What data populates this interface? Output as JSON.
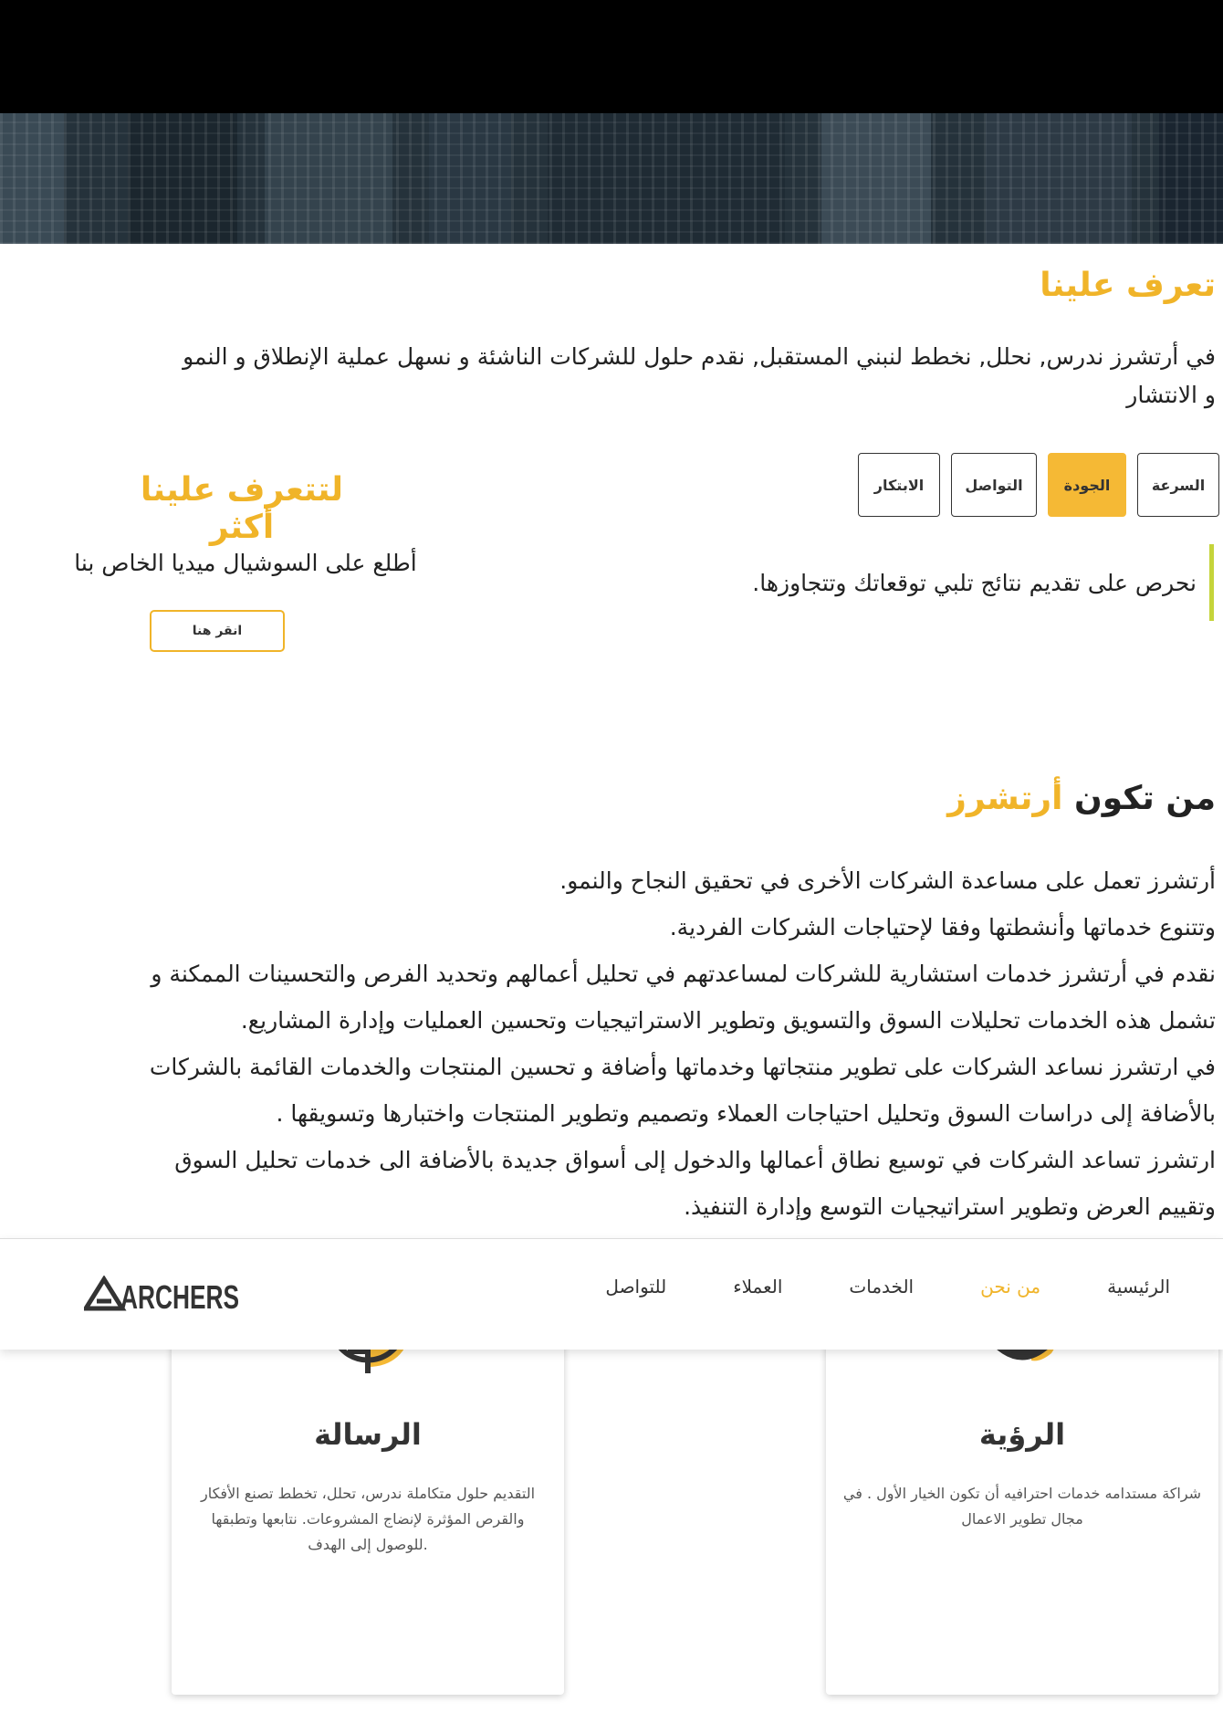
{
  "about": {
    "title": "تعرف علينا",
    "text": "في أرتشرز ندرس, نحلل, نخطط لنبني المستقبل, نقدم حلول للشركات الناشئة و نسهل عملية الإنطلاق و النمو و الانتشار"
  },
  "tabs": [
    {
      "label": "السرعة"
    },
    {
      "label": "الجودة"
    },
    {
      "label": "التواصل"
    },
    {
      "label": "الابتكار"
    }
  ],
  "tab_content": "نحرص على تقديم نتائج تلبي توقعاتك وتتجاوزها.",
  "learn": {
    "title": "لتتعرف علينا أكثر",
    "subtitle": "أطلع على السوشيال ميديا الخاص بنا",
    "button": "انقر هنا"
  },
  "who": {
    "title_prefix": "من تكون",
    "title_brand": "أرتشرز",
    "lines": [
      "أرتشرز تعمل على مساعدة الشركات الأخرى في تحقيق النجاح والنمو.",
      "وتتنوع خدماتها وأنشطتها وفقا لإحتياجات الشركات الفردية.",
      "نقدم في أرتشرز خدمات استشارية للشركات لمساعدتهم في تحليل أعمالهم وتحديد الفرص والتحسينات الممكنة و",
      "تشمل هذه الخدمات تحليلات السوق والتسويق وتطوير الاستراتيجيات وتحسين العمليات وإدارة المشاريع.",
      "في ارتشرز نساعد الشركات على تطوير منتجاتها وخدماتها وأضافة و تحسين المنتجات والخدمات القائمة بالشركات",
      "بالأضافة إلى دراسات السوق وتحليل احتياجات العملاء وتصميم وتطوير المنتجات واختبارها وتسويقها .",
      "ارتشرز تساعد الشركات في توسيع نطاق أعمالها والدخول إلى أسواق جديدة بالأضافة الى خدمات تحليل السوق",
      "وتقييم العرض وتطوير استراتيجيات التوسع وإدارة التنفيذ."
    ]
  },
  "navbar": {
    "logo_text": "ARCHERS",
    "items": [
      {
        "label": "الرئيسية"
      },
      {
        "label": "من نحن"
      },
      {
        "label": "الخدمات"
      },
      {
        "label": "العملاء"
      },
      {
        "label": "للتواصل"
      }
    ],
    "active_index": 1
  },
  "cards": {
    "vision": {
      "title": "الرؤية",
      "text": "شراكة مستدامه خدمات احترافيه أن تكون الخيار الأول . في مجال تطوير الاعمال",
      "icon": "eye-icon"
    },
    "mission": {
      "title": "الرسالة",
      "text": "التقديم حلول متكاملة ندرس، تحلل، تخطط تصنع الأفكار والقرص المؤثرة لإنضاج المشروعات. نتابعها وتطبقها .للوصول إلى الهدف",
      "icon": "target-icon"
    }
  },
  "colors": {
    "accent": "#f0b429",
    "tab_active": "#f5b935",
    "border_accent": "#c5d43a"
  }
}
